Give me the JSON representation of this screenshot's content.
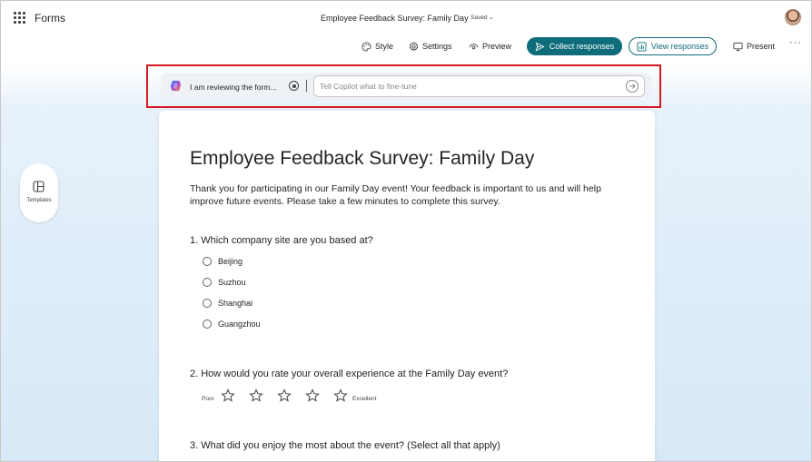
{
  "app": {
    "name": "Forms"
  },
  "document": {
    "title": "Employee Feedback Survey: Family Day",
    "save_status": "Saved"
  },
  "toolbar": {
    "style": "Style",
    "settings": "Settings",
    "preview": "Preview",
    "collect_responses": "Collect responses",
    "view_responses": "View responses",
    "present": "Present",
    "more": "···"
  },
  "copilot": {
    "status": "I am reviewing the form...",
    "placeholder": "Tell Copilot what to fine-tune"
  },
  "sidebar": {
    "templates": "Templates"
  },
  "form": {
    "title": "Employee Feedback Survey: Family Day",
    "description": "Thank you for participating in our Family Day event! Your feedback is important to us and will help improve future events. Please take a few minutes to complete this survey.",
    "questions": [
      {
        "text": "1. Which company site are you based at?",
        "options": [
          "Beijing",
          "Suzhou",
          "Shanghai",
          "Guangzhou"
        ]
      },
      {
        "text": "2. How would you rate your overall experience at the Family Day event?",
        "rating": {
          "low": "Poor",
          "high": "Excellent",
          "stars": 5
        }
      },
      {
        "text": "3. What did you enjoy the most about the event? (Select all that apply)"
      }
    ]
  },
  "colors": {
    "accent": "#0f6c7a",
    "highlight": "#d6181e"
  }
}
